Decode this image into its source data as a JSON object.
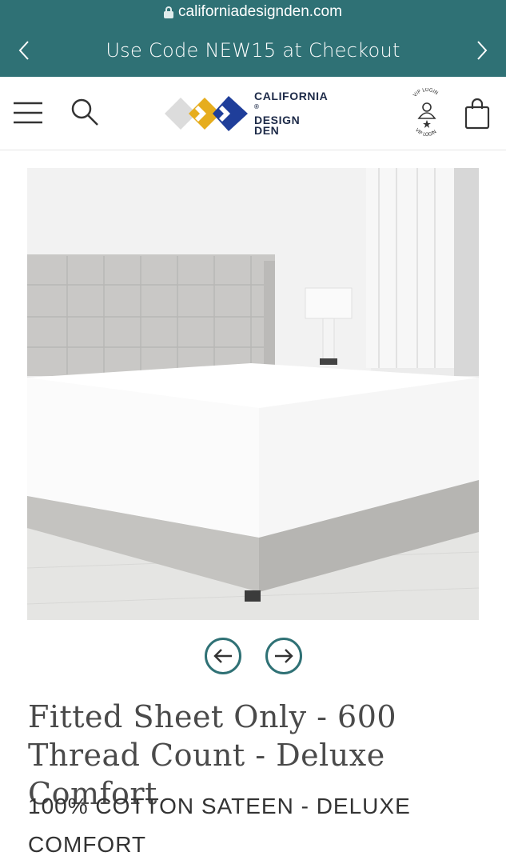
{
  "browser": {
    "url": "californiadesignden.com"
  },
  "promo": {
    "text": "Use Code NEW15 at Checkout",
    "prev_icon": "chevron-left-icon",
    "next_icon": "chevron-right-icon"
  },
  "header": {
    "menu_icon": "hamburger-menu-icon",
    "search_icon": "search-icon",
    "logo": {
      "line1": "CALIFORNIA",
      "line2": "DESIGN",
      "line3": "DEN",
      "registered": "®",
      "colors": [
        "#d9d9d9",
        "#e6ad1e",
        "#1f3e9a"
      ]
    },
    "vip": {
      "top_text": "VIP LOGIN",
      "bottom_text": "VIP LOGIN",
      "icon": "user-icon"
    },
    "cart_icon": "shopping-bag-icon"
  },
  "product": {
    "image_alt": "white fitted sheet on upholstered bed",
    "title": "Fitted Sheet Only - 600 Thread Count - Deluxe Comfort",
    "subtitle": "100% COTTON SATEEN - DELUXE COMFORT"
  },
  "carousel": {
    "prev_icon": "arrow-left-circle-icon",
    "next_icon": "arrow-right-circle-icon"
  },
  "colors": {
    "accent": "#2f7175",
    "text": "#333333"
  }
}
